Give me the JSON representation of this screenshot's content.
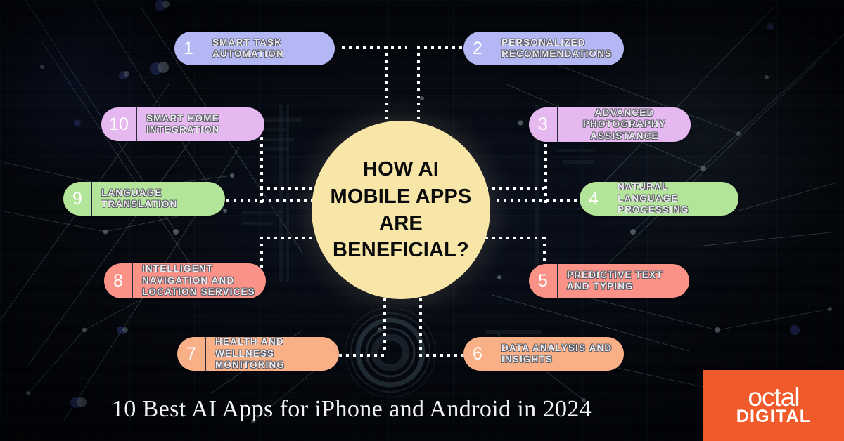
{
  "center": {
    "text": "HOW AI MOBILE APPS ARE BENEFICIAL?",
    "bg_color": "#f8e6a8",
    "text_color": "#0b0b0b"
  },
  "items": [
    {
      "number": "1",
      "label": "SMART TASK AUTOMATION",
      "color": "#b3b8f5"
    },
    {
      "number": "2",
      "label": "PERSONALIZED RECOMMENDATIONS",
      "color": "#b3b8f5"
    },
    {
      "number": "3",
      "label": "ADVANCED PHOTOGRAPHY ASSISTANCE",
      "color": "#e5b8ef"
    },
    {
      "number": "4",
      "label": "NATURAL LANGUAGE PROCESSING",
      "color": "#b2e49a"
    },
    {
      "number": "5",
      "label": "PREDICTIVE TEXT AND TYPING",
      "color": "#fa9287"
    },
    {
      "number": "6",
      "label": "DATA ANALYSIS AND INSIGHTS",
      "color": "#f9b087"
    },
    {
      "number": "7",
      "label": "HEALTH AND WELLNESS MONITORING",
      "color": "#f9b087"
    },
    {
      "number": "8",
      "label": "INTELLIGENT NAVIGATION AND LOCATION SERVICES",
      "color": "#fa9287"
    },
    {
      "number": "9",
      "label": "LANGUAGE TRANSLATION",
      "color": "#b2e49a"
    },
    {
      "number": "10",
      "label": "SMART HOME INTEGRATION",
      "color": "#e5b8ef"
    }
  ],
  "footer": {
    "title": "10 Best AI Apps for iPhone and Android in 2024"
  },
  "logo": {
    "word_primary": "octal",
    "word_secondary": "DIGITAL",
    "bg_color": "#f15b2b",
    "text_color": "#ffffff"
  },
  "background": {
    "base_color": "#04060c",
    "accent_color": "#3c6e96"
  }
}
